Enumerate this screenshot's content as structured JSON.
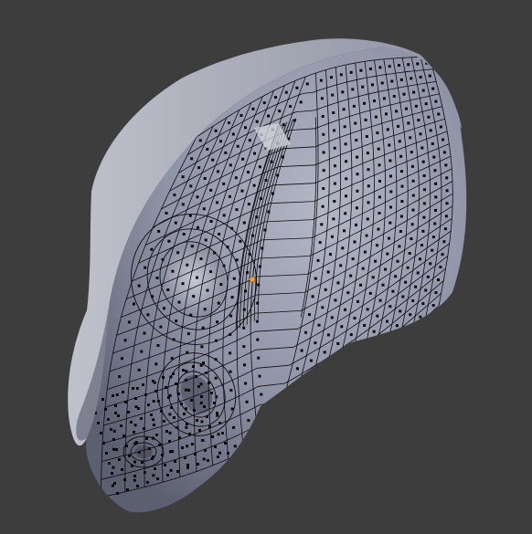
{
  "viewport": {
    "background_color": "#3d3d3d",
    "mesh_fill_color": "#8a8ea3",
    "mesh_highlight_color": "#c9ccd8",
    "mesh_shadow_color": "#5b5e6e",
    "wire_color": "#000000",
    "vertex_color": "#000000",
    "selected_vertex_color": "#f0a030",
    "icons": {
      "mesh": "sculpted-head-mesh-icon",
      "wireframe": "wireframe-grid-icon",
      "vertex": "vertex-dot-icon",
      "cursor": "selected-vertex-icon"
    }
  }
}
